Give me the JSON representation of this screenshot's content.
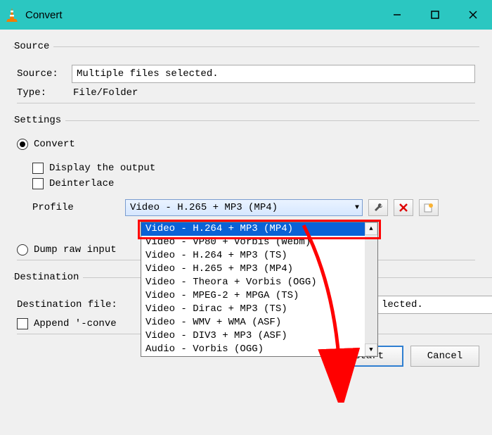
{
  "window": {
    "title": "Convert"
  },
  "source": {
    "legend": "Source",
    "source_label": "Source:",
    "source_value": "Multiple files selected.",
    "type_label": "Type:",
    "type_value": "File/Folder"
  },
  "settings": {
    "legend": "Settings",
    "convert_label": "Convert",
    "display_label": "Display the output",
    "deinterlace_label": "Deinterlace",
    "profile_label": "Profile",
    "profile_selected": "Video - H.265 + MP3 (MP4)",
    "dump_label": "Dump raw input",
    "options": [
      "Video - H.264 + MP3 (MP4)",
      "Video - VP80 + Vorbis (Webm)",
      "Video - H.264 + MP3 (TS)",
      "Video - H.265 + MP3 (MP4)",
      "Video - Theora + Vorbis (OGG)",
      "Video - MPEG-2 + MPGA (TS)",
      "Video - Dirac + MP3 (TS)",
      "Video - WMV + WMA (ASF)",
      "Video - DIV3 + MP3 (ASF)",
      "Audio - Vorbis (OGG)"
    ],
    "tools": {
      "wrench": "wrench-icon",
      "delete": "delete-icon",
      "new": "new-profile-icon"
    }
  },
  "destination": {
    "legend": "Destination",
    "file_label": "Destination file:",
    "file_value": "lected.",
    "append_label": "Append '-conve"
  },
  "buttons": {
    "start": "Start",
    "cancel": "Cancel"
  }
}
